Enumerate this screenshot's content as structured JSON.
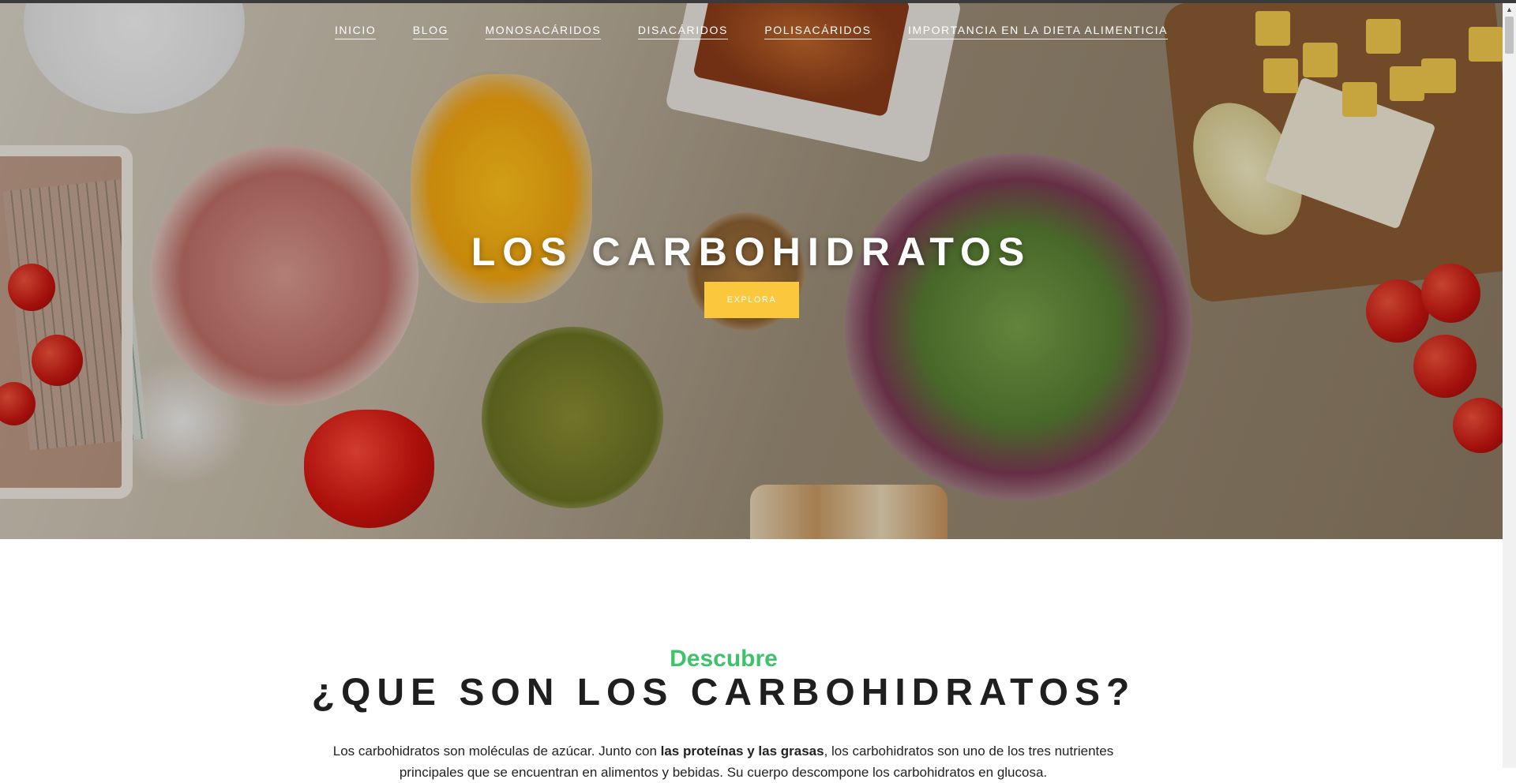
{
  "nav": {
    "items": [
      "INICIO",
      "BLOG",
      "MONOSACÁRIDOS",
      "DISACÁRIDOS",
      "POLISACÁRIDOS",
      "IMPORTANCIA EN LA DIETA ALIMENTICIA"
    ]
  },
  "hero": {
    "title": "LOS CARBOHIDRATOS",
    "button_label": "EXPLORA"
  },
  "section": {
    "kicker": "Descubre",
    "title": "¿QUE SON LOS CARBOHIDRATOS?",
    "intro_part1": "Los carbohidratos son moléculas de azúcar. Junto con ",
    "intro_bold": "las proteínas y las grasas",
    "intro_part2": ", los carbohidratos son uno de los tres nutrientes principales que se encuentran en alimentos y bebidas. Su cuerpo descompone los carbohidratos en glucosa."
  },
  "colors": {
    "accent_green": "#3ec26b",
    "button_yellow": "#fbc83d",
    "heading_dark": "#1f1f1f"
  }
}
